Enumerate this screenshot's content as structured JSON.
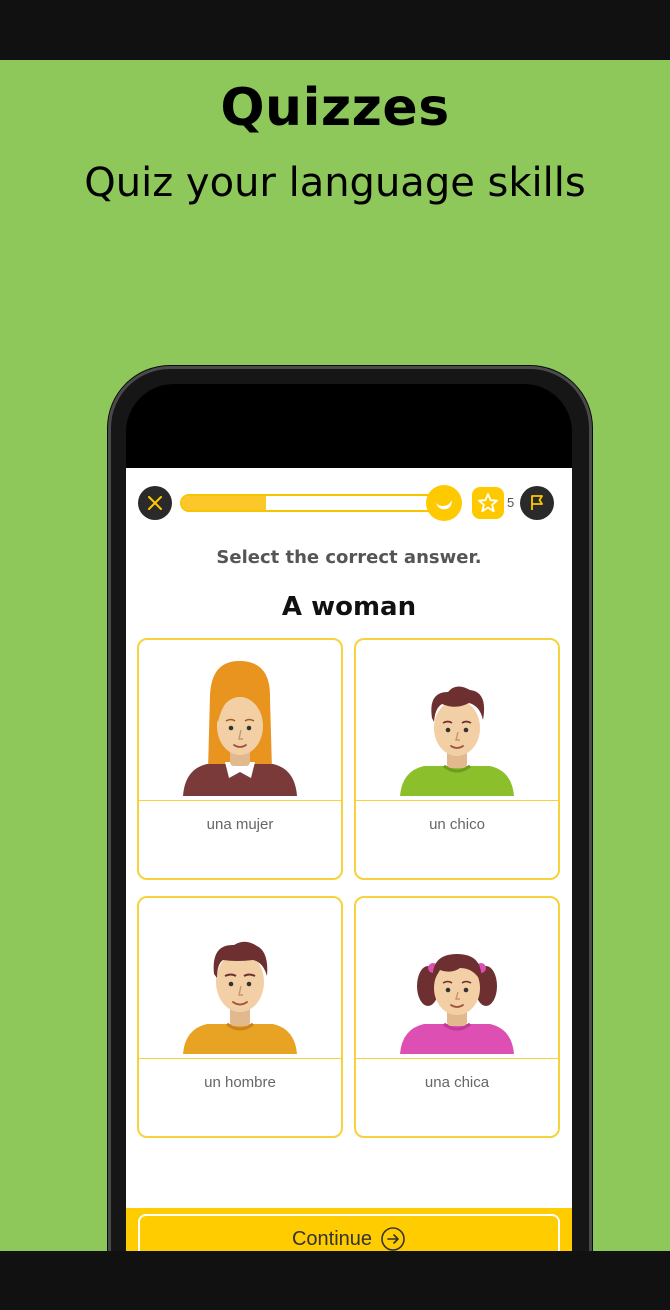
{
  "marketing": {
    "headline": "Quizzes",
    "subheadline": "Quiz your language skills"
  },
  "quiz": {
    "progress_fraction": 0.33,
    "star_count": "5",
    "instruction": "Select the correct answer.",
    "prompt": "A woman",
    "options": [
      {
        "label": "una mujer",
        "icon": "woman-avatar-icon"
      },
      {
        "label": "un chico",
        "icon": "boy-avatar-icon"
      },
      {
        "label": "un hombre",
        "icon": "man-avatar-icon"
      },
      {
        "label": "una chica",
        "icon": "girl-avatar-icon"
      }
    ],
    "continue_label": "Continue"
  },
  "colors": {
    "background": "#8ec85a",
    "accent": "#ffcc00",
    "card_border": "#f7d23c"
  }
}
